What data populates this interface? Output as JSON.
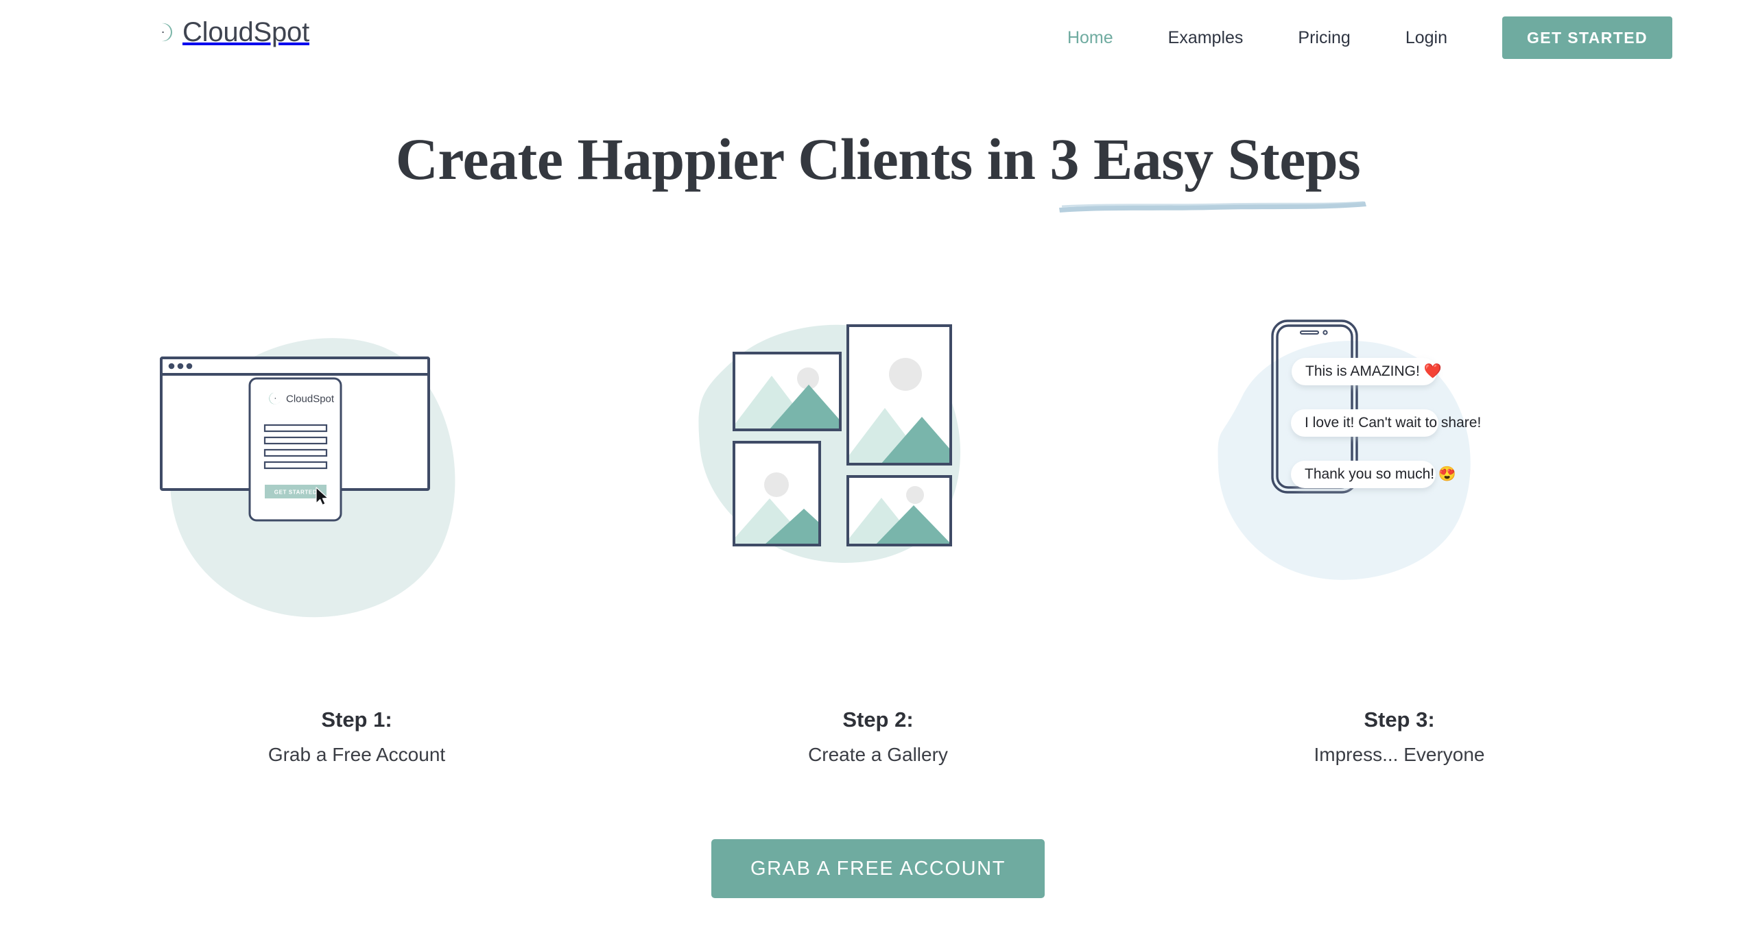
{
  "brand": {
    "name": "CloudSpot",
    "logo_icon": "cloudspot-c-mark",
    "accent_color": "#6faba0",
    "text_color": "#3f4450"
  },
  "nav": {
    "items": [
      {
        "label": "Home",
        "active": true
      },
      {
        "label": "Examples",
        "active": false
      },
      {
        "label": "Pricing",
        "active": false
      },
      {
        "label": "Login",
        "active": false
      }
    ],
    "cta_label": "GET STARTED"
  },
  "hero": {
    "headline": "Create Happier Clients in 3 Easy Steps",
    "underline_color": "#a9c7d8"
  },
  "steps": [
    {
      "title": "Step 1:",
      "subtitle": "Grab a Free Account",
      "art": {
        "type": "browser-signup",
        "blob_color": "#e3eeed",
        "outline_color": "#3f4b66",
        "card_logo_text": "CloudSpot",
        "card_button_label": "GET STARTED",
        "card_button_color": "#a9cdc6",
        "field_count": 4,
        "cursor": "arrow-pointer"
      }
    },
    {
      "title": "Step 2:",
      "subtitle": "Create a Gallery",
      "art": {
        "type": "photo-gallery",
        "blob_color": "#dfedeb",
        "outline_color": "#3f4b66",
        "mountain_back_color": "#d6ebe6",
        "mountain_front_color": "#79b5ab",
        "sun_color": "#e8e8e8",
        "frames": 4
      }
    },
    {
      "title": "Step 3:",
      "subtitle": "Impress... Everyone",
      "art": {
        "type": "phone-messages",
        "blob_color": "#eaf3f8",
        "outline_color": "#3f4b66",
        "messages": [
          {
            "text": "This is AMAZING!",
            "emoji": "❤️"
          },
          {
            "text": "I love it! Can't wait to share!",
            "emoji": ""
          },
          {
            "text": "Thank you so much!",
            "emoji": "😍"
          }
        ]
      }
    }
  ],
  "footer_cta": {
    "label": "GRAB A FREE ACCOUNT",
    "color": "#6faba0"
  }
}
